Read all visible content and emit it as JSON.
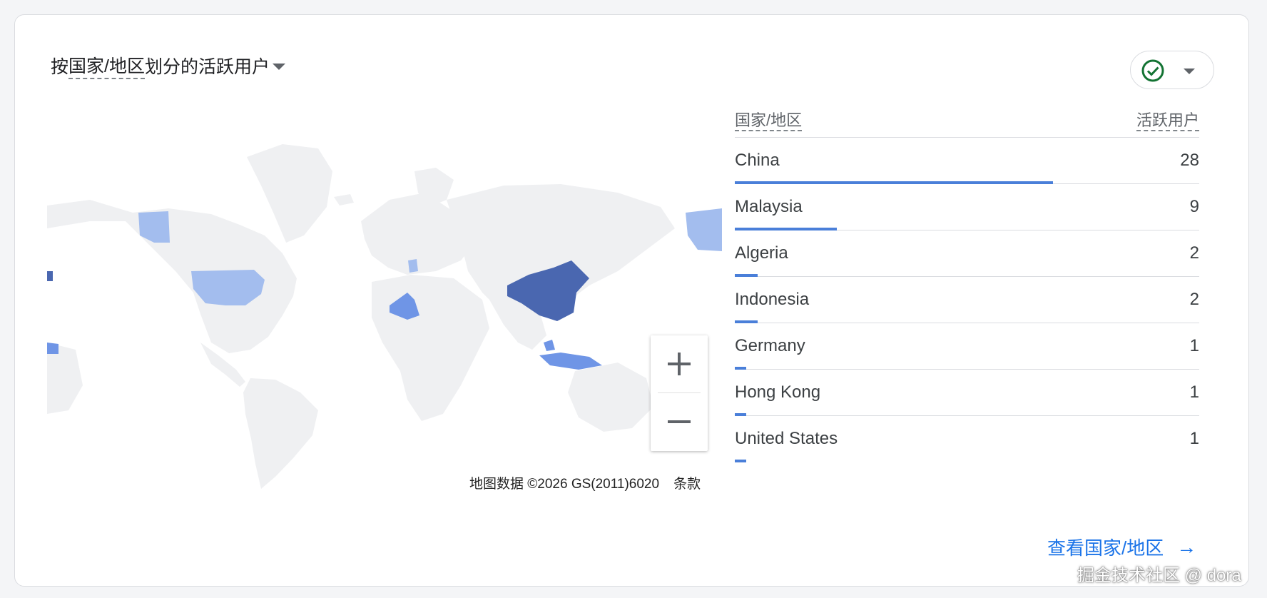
{
  "card": {
    "title_part1": "按",
    "title_underlined": "国家/地区",
    "title_part2": "划分的活跃用户"
  },
  "status_icon": "check-circle-icon",
  "table": {
    "col_country": "国家/地区",
    "col_users": "活跃用户",
    "rows": [
      {
        "country": "China",
        "users": "28"
      },
      {
        "country": "Malaysia",
        "users": "9"
      },
      {
        "country": "Algeria",
        "users": "2"
      },
      {
        "country": "Indonesia",
        "users": "2"
      },
      {
        "country": "Germany",
        "users": "1"
      },
      {
        "country": "Hong Kong",
        "users": "1"
      },
      {
        "country": "United States",
        "users": "1"
      }
    ]
  },
  "map": {
    "attribution": "地图数据 ©2026 GS(2011)6020",
    "terms": "条款",
    "zoom_in_icon": "plus-icon",
    "zoom_out_icon": "minus-icon"
  },
  "footer": {
    "link_label": "查看国家/地区",
    "link_icon": "arrow-right-icon"
  },
  "watermark": "掘金技术社区 @ dora",
  "colors": {
    "accent": "#1a73e8",
    "bar": "#4a7fd9",
    "china": "#4a67b0",
    "high": "#6f95e6",
    "low": "#a3bdee",
    "land": "#eff0f2"
  }
}
